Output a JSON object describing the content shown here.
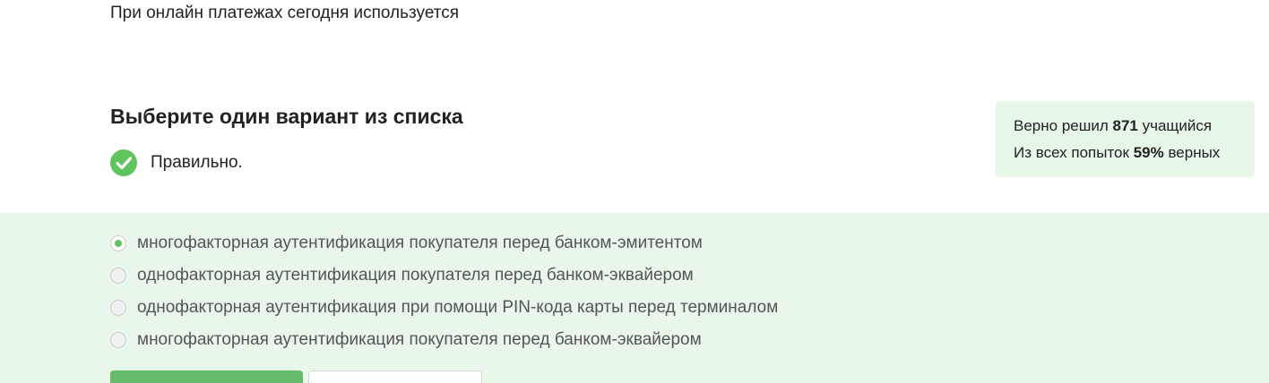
{
  "question": {
    "text": "При онлайн платежах сегодня используется"
  },
  "instruction": "Выберите один вариант из списка",
  "feedback": {
    "icon": "check-circle-icon",
    "text": "Правильно.",
    "icon_color": "#5ec45e"
  },
  "stats": {
    "solved_prefix": "Верно решил ",
    "solved_count": "871",
    "solved_suffix": " учащийся",
    "attempts_prefix": "Из всех попыток ",
    "attempts_percent": "59%",
    "attempts_suffix": " верных"
  },
  "options": [
    {
      "label": "многофакторная аутентификация покупателя перед банком-эмитентом",
      "selected": true
    },
    {
      "label": "однофакторная аутентификация покупателя перед банком-эквайером",
      "selected": false
    },
    {
      "label": "однофакторная аутентификация при помощи PIN-кода карты перед терминалом",
      "selected": false
    },
    {
      "label": "многофакторная аутентификация покупателя перед банком-эквайером",
      "selected": false
    }
  ],
  "colors": {
    "accent_green": "#66bb6a",
    "options_background": "#e8f7e9",
    "stats_background": "#e6f6e7"
  }
}
